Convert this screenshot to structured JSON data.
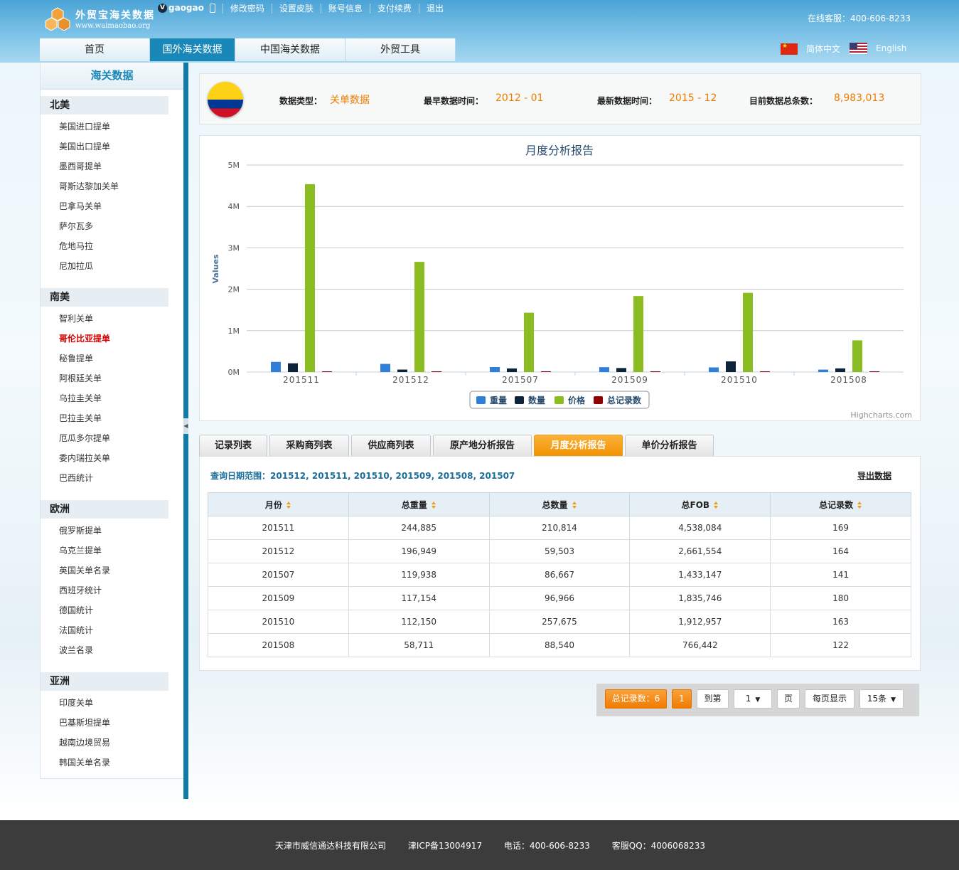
{
  "header": {
    "logo_cn": "外贸宝海关数据",
    "logo_url": "www.waimaobao.org",
    "username": "gaogao",
    "links": [
      "修改密码",
      "设置皮肤",
      "账号信息",
      "支付续费",
      "退出"
    ],
    "hotline": "在线客服：400-606-8233",
    "tabs": [
      "首页",
      "国外海关数据",
      "中国海关数据",
      "外贸工具"
    ],
    "active_tab": "国外海关数据",
    "lang_cn": "简体中文",
    "lang_en": "English"
  },
  "sidebar": {
    "title": "海关数据",
    "regions": [
      {
        "name": "北美",
        "items": [
          "美国进口提单",
          "美国出口提单",
          "墨西哥提单",
          "哥斯达黎加关单",
          "巴拿马关单",
          "萨尔瓦多",
          "危地马拉",
          "尼加拉瓜"
        ]
      },
      {
        "name": "南美",
        "items": [
          "智利关单",
          "哥伦比亚提单",
          "秘鲁提单",
          "阿根廷关单",
          "乌拉圭关单",
          "巴拉圭关单",
          "厄瓜多尔提单",
          "委内瑞拉关单",
          "巴西统计"
        ]
      },
      {
        "name": "欧洲",
        "items": [
          "俄罗斯提单",
          "乌克兰提单",
          "英国关单名录",
          "西班牙统计",
          "德国统计",
          "法国统计",
          "波兰名录"
        ]
      },
      {
        "name": "亚洲",
        "items": [
          "印度关单",
          "巴基斯坦提单",
          "越南边境贸易",
          "韩国关单名录"
        ]
      }
    ],
    "active_item": "哥伦比亚提单"
  },
  "info": {
    "type_label": "数据类型：",
    "type_value": "关单数据",
    "earliest_label": "最早数据时间：",
    "earliest_value": "2012 - 01",
    "latest_label": "最新数据时间：",
    "latest_value": "2015 - 12",
    "total_label": "目前数据总条数：",
    "total_value": "8,983,013"
  },
  "chart_data": {
    "type": "bar",
    "title": "月度分析报告",
    "xlabel": "",
    "ylabel": "Values",
    "ylim": [
      0,
      5000000
    ],
    "yticks": [
      "0M",
      "1M",
      "2M",
      "3M",
      "4M",
      "5M"
    ],
    "categories": [
      "201511",
      "201512",
      "201507",
      "201509",
      "201510",
      "201508"
    ],
    "series": [
      {
        "name": "重量",
        "color": "#2f7ed8",
        "values": [
          244885,
          196949,
          119938,
          117154,
          112150,
          58711
        ]
      },
      {
        "name": "数量",
        "color": "#0d233a",
        "values": [
          210814,
          59503,
          86667,
          96966,
          257675,
          88540
        ]
      },
      {
        "name": "价格",
        "color": "#8bbc21",
        "values": [
          4538084,
          2661554,
          1433147,
          1835746,
          1912957,
          766442
        ]
      },
      {
        "name": "总记录数",
        "color": "#910000",
        "values": [
          169,
          164,
          141,
          180,
          163,
          122
        ]
      }
    ],
    "grid": true,
    "legend": "bottom-center",
    "credits": "Highcharts.com"
  },
  "report_tabs": [
    "记录列表",
    "采购商列表",
    "供应商列表",
    "原产地分析报告",
    "月度分析报告",
    "单价分析报告"
  ],
  "active_report_tab": "月度分析报告",
  "table": {
    "query_label": "查询日期范围：",
    "query_value": "201512, 201511, 201510, 201509, 201508, 201507",
    "export_label": "导出数据",
    "headers": [
      "月份",
      "总重量",
      "总数量",
      "总FOB",
      "总记录数"
    ],
    "rows": [
      [
        "201511",
        "244,885",
        "210,814",
        "4,538,084",
        "169"
      ],
      [
        "201512",
        "196,949",
        "59,503",
        "2,661,554",
        "164"
      ],
      [
        "201507",
        "119,938",
        "86,667",
        "1,433,147",
        "141"
      ],
      [
        "201509",
        "117,154",
        "96,966",
        "1,835,746",
        "180"
      ],
      [
        "201510",
        "112,150",
        "257,675",
        "1,912,957",
        "163"
      ],
      [
        "201508",
        "58,711",
        "88,540",
        "766,442",
        "122"
      ]
    ]
  },
  "pager": {
    "total": "总记录数：6",
    "current_page": "1",
    "goto_label": "到第",
    "page_select": "1",
    "page_suffix": "页",
    "per_page_label": "每页显示",
    "per_page_select": "15条"
  },
  "footer": {
    "company": "天津市威信通达科技有限公司",
    "icp": "津ICP备13004917",
    "phone": "电话：400-606-8233",
    "qq": "客服QQ：4006068233"
  }
}
